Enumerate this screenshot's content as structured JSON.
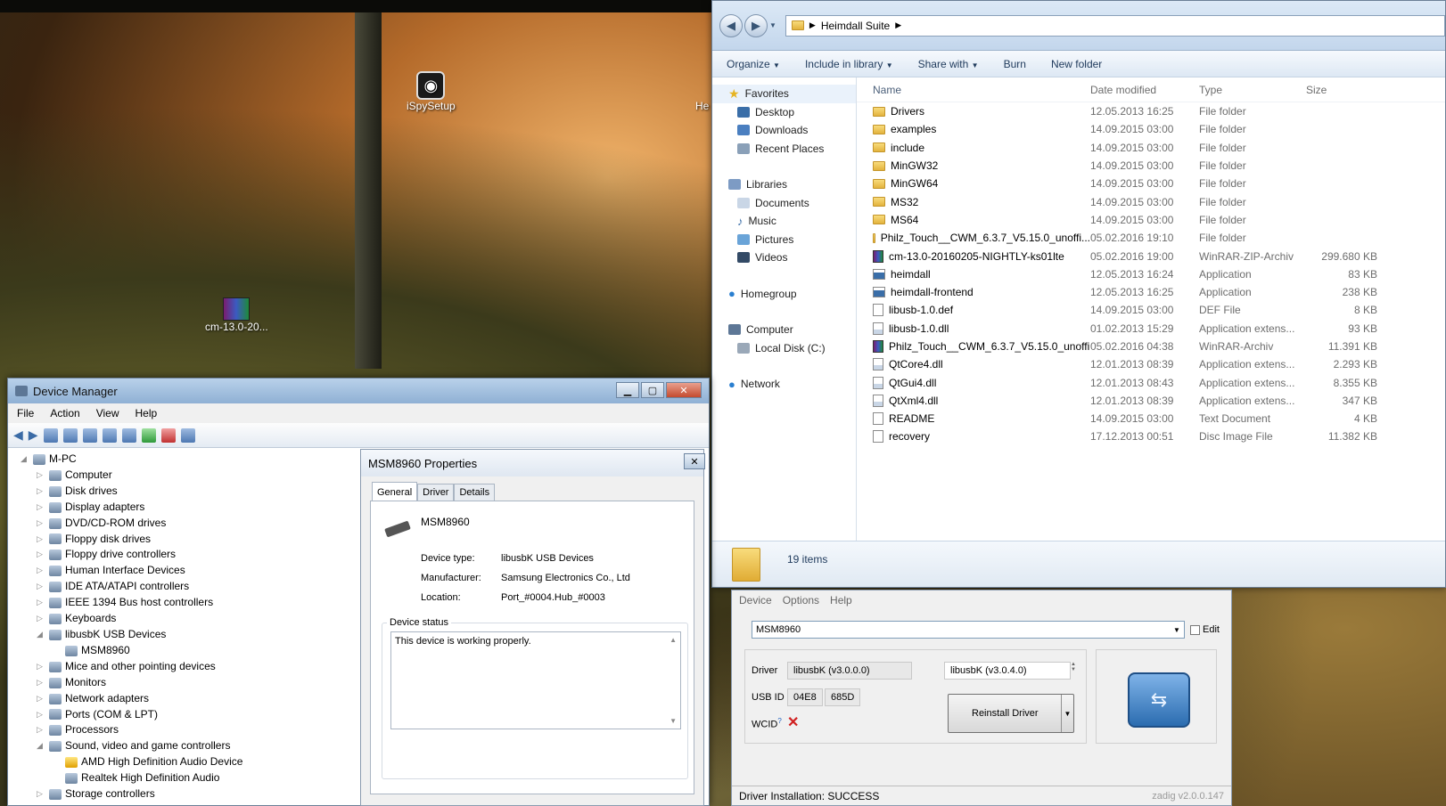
{
  "desktop": {
    "icons": [
      {
        "label": "iSpySetup"
      },
      {
        "label": "cm-13.0-20..."
      }
    ],
    "partial_label": "He"
  },
  "explorer": {
    "breadcrumb": "Heimdall Suite",
    "toolbar": [
      "Organize",
      "Include in library",
      "Share with",
      "Burn",
      "New folder"
    ],
    "nav": {
      "favorites": "Favorites",
      "favorites_items": [
        "Desktop",
        "Downloads",
        "Recent Places"
      ],
      "libraries": "Libraries",
      "libraries_items": [
        "Documents",
        "Music",
        "Pictures",
        "Videos"
      ],
      "homegroup": "Homegroup",
      "computer": "Computer",
      "computer_items": [
        "Local Disk (C:)"
      ],
      "network": "Network"
    },
    "columns": [
      "Name",
      "Date modified",
      "Type",
      "Size"
    ],
    "files": [
      {
        "name": "Drivers",
        "date": "12.05.2013 16:25",
        "type": "File folder",
        "size": "",
        "kind": "folder"
      },
      {
        "name": "examples",
        "date": "14.09.2015 03:00",
        "type": "File folder",
        "size": "",
        "kind": "folder"
      },
      {
        "name": "include",
        "date": "14.09.2015 03:00",
        "type": "File folder",
        "size": "",
        "kind": "folder"
      },
      {
        "name": "MinGW32",
        "date": "14.09.2015 03:00",
        "type": "File folder",
        "size": "",
        "kind": "folder"
      },
      {
        "name": "MinGW64",
        "date": "14.09.2015 03:00",
        "type": "File folder",
        "size": "",
        "kind": "folder"
      },
      {
        "name": "MS32",
        "date": "14.09.2015 03:00",
        "type": "File folder",
        "size": "",
        "kind": "folder"
      },
      {
        "name": "MS64",
        "date": "14.09.2015 03:00",
        "type": "File folder",
        "size": "",
        "kind": "folder"
      },
      {
        "name": "Philz_Touch__CWM_6.3.7_V5.15.0_unoffi...",
        "date": "05.02.2016 19:10",
        "type": "File folder",
        "size": "",
        "kind": "folder"
      },
      {
        "name": "cm-13.0-20160205-NIGHTLY-ks01lte",
        "date": "05.02.2016 19:00",
        "type": "WinRAR-ZIP-Archiv",
        "size": "299.680 KB",
        "kind": "rar"
      },
      {
        "name": "heimdall",
        "date": "12.05.2013 16:24",
        "type": "Application",
        "size": "83 KB",
        "kind": "app"
      },
      {
        "name": "heimdall-frontend",
        "date": "12.05.2013 16:25",
        "type": "Application",
        "size": "238 KB",
        "kind": "app"
      },
      {
        "name": "libusb-1.0.def",
        "date": "14.09.2015 03:00",
        "type": "DEF File",
        "size": "8 KB",
        "kind": "file"
      },
      {
        "name": "libusb-1.0.dll",
        "date": "01.02.2013 15:29",
        "type": "Application extens...",
        "size": "93 KB",
        "kind": "dll"
      },
      {
        "name": "Philz_Touch__CWM_6.3.7_V5.15.0_unoffi...",
        "date": "05.02.2016 04:38",
        "type": "WinRAR-Archiv",
        "size": "11.391 KB",
        "kind": "rar"
      },
      {
        "name": "QtCore4.dll",
        "date": "12.01.2013 08:39",
        "type": "Application extens...",
        "size": "2.293 KB",
        "kind": "dll"
      },
      {
        "name": "QtGui4.dll",
        "date": "12.01.2013 08:43",
        "type": "Application extens...",
        "size": "8.355 KB",
        "kind": "dll"
      },
      {
        "name": "QtXml4.dll",
        "date": "12.01.2013 08:39",
        "type": "Application extens...",
        "size": "347 KB",
        "kind": "dll"
      },
      {
        "name": "README",
        "date": "14.09.2015 03:00",
        "type": "Text Document",
        "size": "4 KB",
        "kind": "file"
      },
      {
        "name": "recovery",
        "date": "17.12.2013 00:51",
        "type": "Disc Image File",
        "size": "11.382 KB",
        "kind": "file"
      }
    ],
    "status": "19 items"
  },
  "devmgr": {
    "title": "Device Manager",
    "menu": [
      "File",
      "Action",
      "View",
      "Help"
    ],
    "tree": [
      {
        "label": "M-PC",
        "level": 0,
        "arrow": "◢"
      },
      {
        "label": "Computer",
        "level": 1,
        "arrow": "▷"
      },
      {
        "label": "Disk drives",
        "level": 1,
        "arrow": "▷"
      },
      {
        "label": "Display adapters",
        "level": 1,
        "arrow": "▷"
      },
      {
        "label": "DVD/CD-ROM drives",
        "level": 1,
        "arrow": "▷"
      },
      {
        "label": "Floppy disk drives",
        "level": 1,
        "arrow": "▷"
      },
      {
        "label": "Floppy drive controllers",
        "level": 1,
        "arrow": "▷"
      },
      {
        "label": "Human Interface Devices",
        "level": 1,
        "arrow": "▷"
      },
      {
        "label": "IDE ATA/ATAPI controllers",
        "level": 1,
        "arrow": "▷"
      },
      {
        "label": "IEEE 1394 Bus host controllers",
        "level": 1,
        "arrow": "▷"
      },
      {
        "label": "Keyboards",
        "level": 1,
        "arrow": "▷"
      },
      {
        "label": "libusbK USB Devices",
        "level": 1,
        "arrow": "◢"
      },
      {
        "label": "MSM8960",
        "level": 2,
        "arrow": ""
      },
      {
        "label": "Mice and other pointing devices",
        "level": 1,
        "arrow": "▷"
      },
      {
        "label": "Monitors",
        "level": 1,
        "arrow": "▷"
      },
      {
        "label": "Network adapters",
        "level": 1,
        "arrow": "▷"
      },
      {
        "label": "Ports (COM & LPT)",
        "level": 1,
        "arrow": "▷"
      },
      {
        "label": "Processors",
        "level": 1,
        "arrow": "▷"
      },
      {
        "label": "Sound, video and game controllers",
        "level": 1,
        "arrow": "◢"
      },
      {
        "label": "AMD High Definition Audio Device",
        "level": 2,
        "arrow": ""
      },
      {
        "label": "Realtek High Definition Audio",
        "level": 2,
        "arrow": ""
      },
      {
        "label": "Storage controllers",
        "level": 1,
        "arrow": "▷"
      }
    ]
  },
  "props": {
    "title": "MSM8960 Properties",
    "tabs": [
      "General",
      "Driver",
      "Details"
    ],
    "device_name": "MSM8960",
    "device_type_label": "Device type:",
    "device_type": "libusbK USB Devices",
    "manufacturer_label": "Manufacturer:",
    "manufacturer": "Samsung Electronics Co., Ltd",
    "location_label": "Location:",
    "location": "Port_#0004.Hub_#0003",
    "status_label": "Device status",
    "status_text": "This device is working properly."
  },
  "zadig": {
    "menu": [
      "Device",
      "Options",
      "Help"
    ],
    "device_selected": "MSM8960",
    "edit_label": "Edit",
    "driver_label": "Driver",
    "driver_current": "libusbK (v3.0.0.0)",
    "driver_target": "libusbK (v3.0.4.0)",
    "usb_id_label": "USB ID",
    "vid": "04E8",
    "pid": "685D",
    "wcid_label": "WCID",
    "wcid_sup": "?",
    "reinstall_label": "Reinstall Driver",
    "status": "Driver Installation: SUCCESS",
    "version": "zadig v2.0.0.147"
  }
}
